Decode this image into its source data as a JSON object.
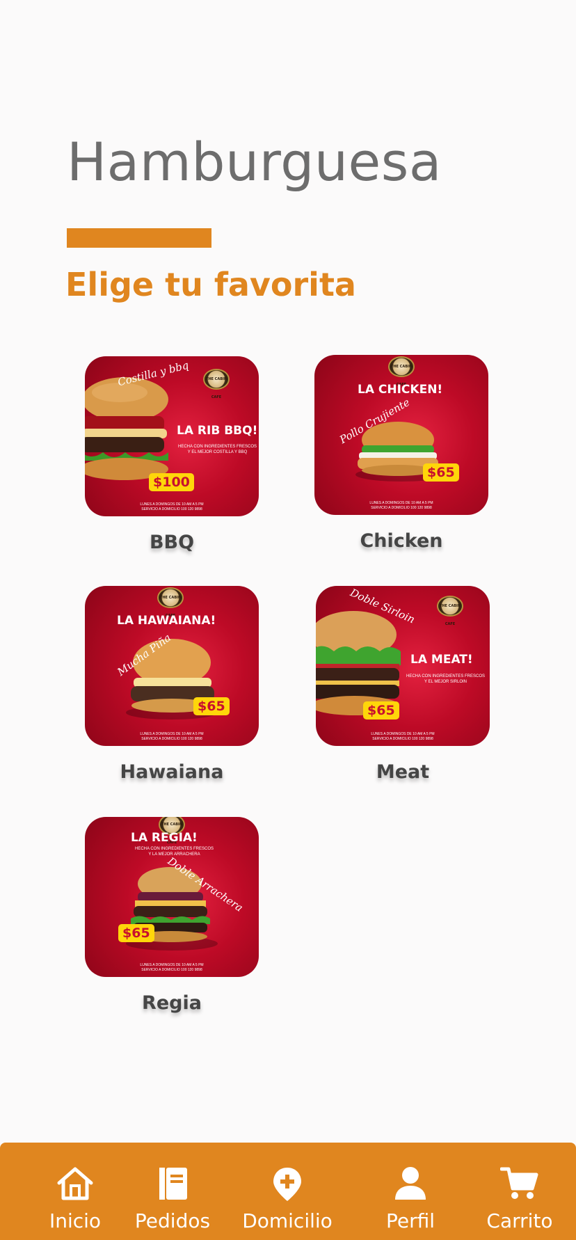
{
  "header": {
    "title": "Hamburguesa",
    "subtitle": "Elige tu favorita"
  },
  "colors": {
    "accent": "#e0861f",
    "title": "#6d6d6d",
    "card_red": "#bd0a26",
    "price_yellow": "#ffd60a",
    "background": "#fbfafa"
  },
  "products": [
    {
      "label": "BBQ",
      "promo_name": "LA RIB BBQ!",
      "promo_script": "Costilla y bbq",
      "promo_desc": "HECHA CON INGREDIENTES FRESCOS\nY EL MEJOR COSTILLA Y BBQ",
      "price": "$100",
      "footer": "LUNES A DOMINGOS DE 10 AM A 5 PM\nSERVICIO A DOMICILIO 100 120 9898"
    },
    {
      "label": "Chicken",
      "promo_name": "LA CHICKEN!",
      "promo_script": "Pollo Crujiente",
      "price": "$65",
      "footer": "LUNES A DOMINGOS DE 10 AM A 5 PM\nSERVICIO A DOMICILIO 100 120 9898"
    },
    {
      "label": "Hawaiana",
      "promo_name": "LA HAWAIANA!",
      "promo_script": "Mucha Piña",
      "price": "$65",
      "footer": "LUNES A DOMINGOS DE 10 AM A 5 PM\nSERVICIO A DOMICILIO 100 120 9898"
    },
    {
      "label": "Meat",
      "promo_name": "LA MEAT!",
      "promo_script": "Doble Sirloin",
      "promo_desc": "HECHA CON INGREDIENTES FRESCOS\nY EL MEJOR SIRLOIN",
      "price": "$65",
      "footer": "LUNES A DOMINGOS DE 10 AM A 5 PM\nSERVICIO A DOMICILIO 100 120 9898"
    },
    {
      "label": "Regia",
      "promo_name": "LA REGIA!",
      "promo_script": "Doble Arrachera",
      "promo_desc": "HECHA CON INGREDIENTES FRESCOS\nY LA MEJOR ARRACHERA",
      "price": "$65",
      "footer": "LUNES A DOMINGOS DE 10 AM A 5 PM\nSERVICIO A DOMICILIO 100 120 9898"
    }
  ],
  "brand_logo_text": "THE CABIN CAFE",
  "nav": [
    {
      "label": "Inicio",
      "icon": "home-icon"
    },
    {
      "label": "Pedidos",
      "icon": "book-icon"
    },
    {
      "label": "Domicilio",
      "icon": "location-plus-icon"
    },
    {
      "label": "Perfil",
      "icon": "user-icon"
    },
    {
      "label": "Carrito",
      "icon": "cart-icon"
    }
  ]
}
